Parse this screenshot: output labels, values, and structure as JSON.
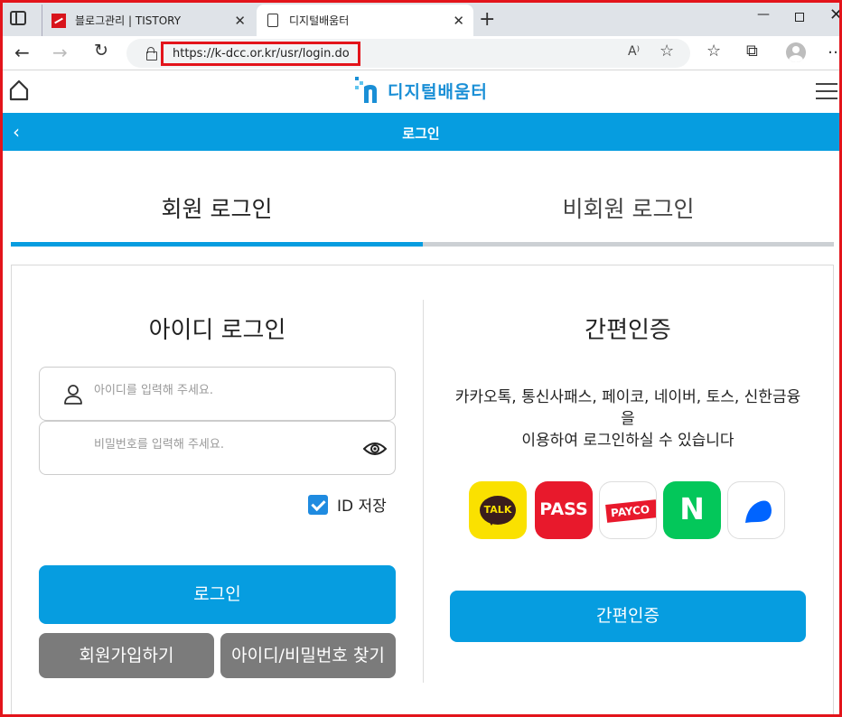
{
  "browser": {
    "tabs": [
      {
        "title": "블로그관리 | TISTORY"
      },
      {
        "title": "디지털배움터"
      }
    ],
    "tab_close": "✕",
    "new_tab": "+",
    "window_min": "—",
    "window_close": "✕",
    "url": "https://k-dcc.or.kr/usr/login.do",
    "read_aloud": "A⁾",
    "nav_back": "←",
    "nav_forward": "→",
    "nav_reload": "↻",
    "tool_favorites": "☆",
    "tool_collections": "⧉",
    "tool_more": "…",
    "favorite_add": "☆"
  },
  "site": {
    "logo_text": "디지털배움터",
    "brand_color": "#069de0",
    "page_title": "로그인",
    "back_glyph": "‹"
  },
  "login_tabs": {
    "member": "회원 로그인",
    "guest": "비회원 로그인",
    "active": "member"
  },
  "id_login": {
    "title": "아이디 로그인",
    "id_placeholder": "아이디를 입력해 주세요.",
    "pw_placeholder": "비밀번호를 입력해 주세요.",
    "save_id_label": "ID 저장",
    "save_id_checked": true,
    "login_button": "로그인",
    "join_button": "회원가입하기",
    "find_button": "아이디/비밀번호 찾기"
  },
  "easy_auth": {
    "title": "간편인증",
    "description": "카카오톡, 통신사패스, 페이코, 네이버, 토스, 신한금융을\n이용하여 로그인하실 수 있습니다",
    "providers": [
      {
        "label": "TALK",
        "icon": "kakao-talk-icon"
      },
      {
        "label": "PASS",
        "icon": "pass-icon"
      },
      {
        "label": "PAYCO",
        "icon": "payco-icon"
      },
      {
        "label": "N",
        "icon": "naver-icon"
      },
      {
        "icon": "toss-icon"
      }
    ],
    "button": "간편인증"
  }
}
